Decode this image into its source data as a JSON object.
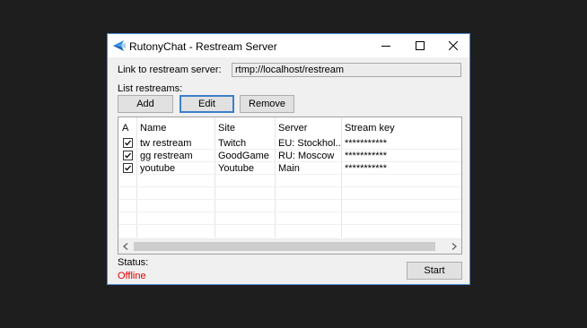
{
  "window": {
    "title": "RutonyChat - Restream Server",
    "accent_border": "#4a8ad8"
  },
  "form": {
    "link_label": "Link to restream server:",
    "link_value": "rtmp://localhost/restream",
    "list_label": "List restreams:"
  },
  "buttons": {
    "add": "Add",
    "edit": "Edit",
    "remove": "Remove",
    "start": "Start"
  },
  "table": {
    "columns": [
      "A",
      "Name",
      "Site",
      "Server",
      "Stream key"
    ],
    "rows": [
      {
        "active": true,
        "name": "tw restream",
        "site": "Twitch",
        "server": "EU: Stockhol...",
        "key": "***********"
      },
      {
        "active": true,
        "name": "gg restream",
        "site": "GoodGame",
        "server": "RU: Moscow",
        "key": "***********"
      },
      {
        "active": true,
        "name": "youtube",
        "site": "Youtube",
        "server": "Main",
        "key": "***********"
      }
    ]
  },
  "status": {
    "label": "Status:",
    "value": "Offline",
    "color": "#e00000"
  },
  "icons": {
    "app": "rutonychat-logo-icon",
    "minimize": "minimize-icon",
    "maximize": "maximize-icon",
    "close": "close-icon",
    "scroll_left": "chevron-left-icon",
    "scroll_right": "chevron-right-icon",
    "check": "checkmark-icon"
  }
}
